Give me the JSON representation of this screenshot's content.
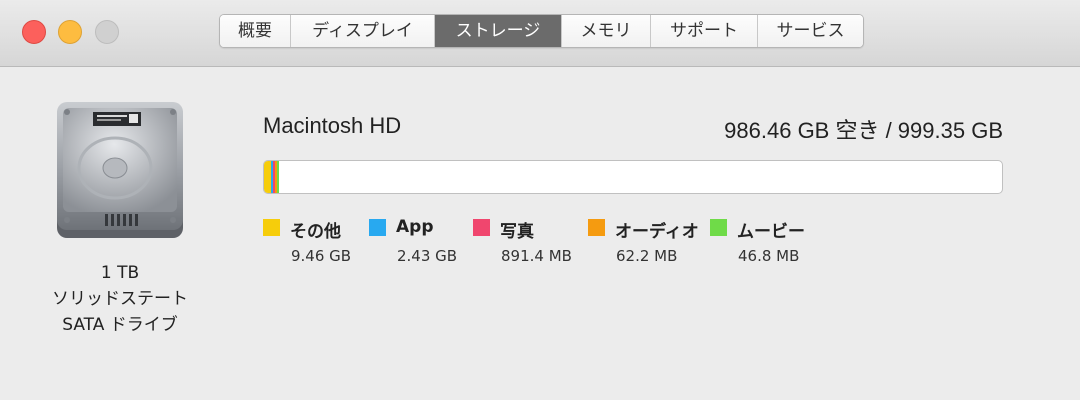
{
  "tabs": [
    {
      "label": "概要",
      "active": false
    },
    {
      "label": "ディスプレイ",
      "active": false
    },
    {
      "label": "ストレージ",
      "active": true
    },
    {
      "label": "メモリ",
      "active": false
    },
    {
      "label": "サポート",
      "active": false
    },
    {
      "label": "サービス",
      "active": false
    }
  ],
  "drive": {
    "icon": "hard-drive-icon",
    "capacity": "1 TB",
    "type": "ソリッドステート",
    "interface": "SATA ドライブ"
  },
  "volume": {
    "name": "Macintosh HD",
    "space": "986.46 GB 空き / 999.35 GB"
  },
  "usage": {
    "segments_fraction_of_total": [
      {
        "category": "その他",
        "fraction": 0.0095,
        "color": "#f6cd0b"
      },
      {
        "category": "App",
        "fraction": 0.0024,
        "color": "#28a9f0"
      },
      {
        "category": "写真",
        "fraction": 0.0009,
        "color": "#f0466e"
      },
      {
        "category": "オーディオ",
        "fraction": 0.0001,
        "color": "#f59b10"
      },
      {
        "category": "ムービー",
        "fraction": 0.0001,
        "color": "#6fdb48"
      }
    ]
  },
  "legend": [
    {
      "label": "その他",
      "size": "9.46 GB",
      "color": "#f6cd0b"
    },
    {
      "label": "App",
      "size": "2.43 GB",
      "color": "#28a9f0"
    },
    {
      "label": "写真",
      "size": "891.4 MB",
      "color": "#f0466e"
    },
    {
      "label": "オーディオ",
      "size": "62.2 MB",
      "color": "#f59b10"
    },
    {
      "label": "ムービー",
      "size": "46.8 MB",
      "color": "#6fdb48"
    }
  ]
}
